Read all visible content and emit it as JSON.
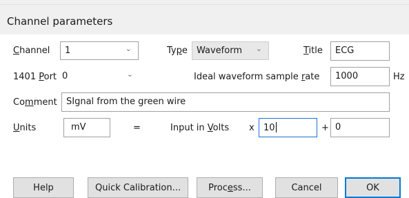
{
  "window": {
    "title": "Channel parameters"
  },
  "channel": {
    "label_pre": "",
    "label_key": "C",
    "label_post": "hannel",
    "value": "1"
  },
  "type": {
    "label_pre": "Ty",
    "label_key": "p",
    "label_post": "e",
    "value": "Waveform"
  },
  "title_field": {
    "label_pre": "",
    "label_key": "T",
    "label_post": "itle",
    "value": "ECG"
  },
  "port": {
    "label_pre": "1401 ",
    "label_key": "P",
    "label_post": "ort",
    "value": "0"
  },
  "rate": {
    "label_pre": "Ideal waveform sample ",
    "label_key": "r",
    "label_post": "ate",
    "value": "1000",
    "unit": "Hz"
  },
  "comment": {
    "label_pre": "Co",
    "label_key": "m",
    "label_post": "ment",
    "value": "SIgnal from the green wire"
  },
  "units": {
    "label_pre": "",
    "label_key": "U",
    "label_post": "nits",
    "value": "mV"
  },
  "equation": {
    "equals": "=",
    "input_pre": "Input in ",
    "input_key": "V",
    "input_post": "olts",
    "x_symbol": "x",
    "scale": "10",
    "plus": "+",
    "offset": "0"
  },
  "buttons": {
    "help": "Help",
    "quick_calibration": "Quick Calibration...",
    "process_pre": "Proc",
    "process_key": "e",
    "process_post": "ss...",
    "cancel": "Cancel",
    "ok": "OK"
  },
  "icons": {
    "dropdown": "chevron-down-icon"
  }
}
